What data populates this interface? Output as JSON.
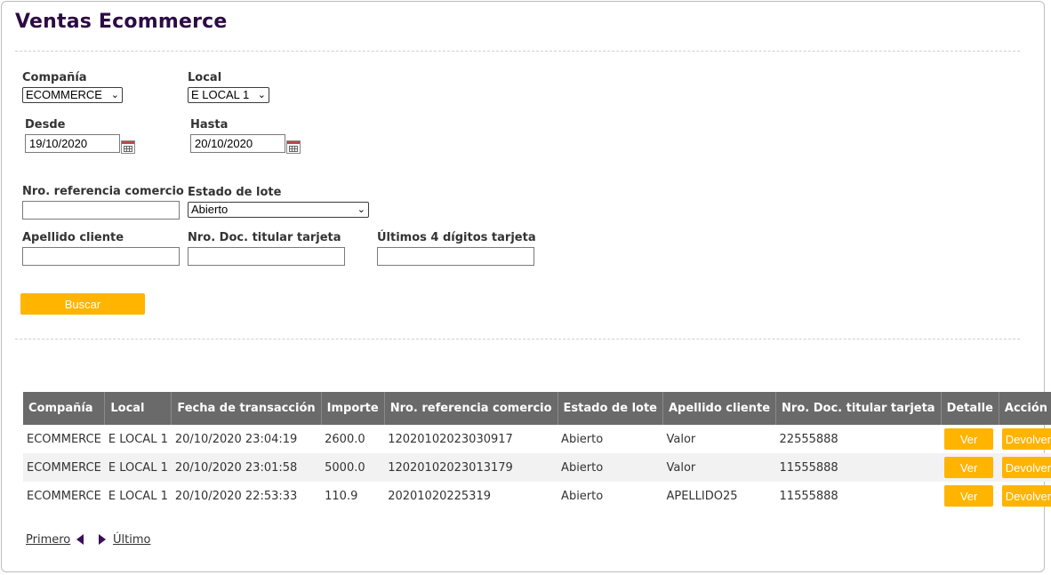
{
  "page": {
    "title": "Ventas Ecommerce"
  },
  "filters": {
    "compania": {
      "label": "Compañía",
      "value": "ECOMMERCE"
    },
    "local": {
      "label": "Local",
      "value": "E LOCAL 1"
    },
    "desde": {
      "label": "Desde",
      "value": "19/10/2020"
    },
    "hasta": {
      "label": "Hasta",
      "value": "20/10/2020"
    },
    "nro_referencia": {
      "label": "Nro. referencia comercio",
      "value": ""
    },
    "estado_lote": {
      "label": "Estado de lote",
      "value": "Abierto"
    },
    "apellido": {
      "label": "Apellido cliente",
      "value": ""
    },
    "nro_doc": {
      "label": "Nro. Doc. titular tarjeta",
      "value": ""
    },
    "ultimos4": {
      "label": "Últimos 4 dígitos tarjeta",
      "value": ""
    },
    "search_label": "Buscar"
  },
  "table": {
    "columns": [
      "Compañía",
      "Local",
      "Fecha de transacción",
      "Importe",
      "Nro. referencia comercio",
      "Estado de lote",
      "Apellido cliente",
      "Nro. Doc. titular tarjeta",
      "Detalle",
      "Acción"
    ],
    "rows": [
      {
        "compania": "ECOMMERCE",
        "local": "E LOCAL 1",
        "fecha": "20/10/2020 23:04:19",
        "importe": "2600.0",
        "referencia": "12020102023030917",
        "estado": "Abierto",
        "apellido": "Valor",
        "doc": "22555888",
        "detalle": "Ver",
        "accion": "Devolver"
      },
      {
        "compania": "ECOMMERCE",
        "local": "E LOCAL 1",
        "fecha": "20/10/2020 23:01:58",
        "importe": "5000.0",
        "referencia": "12020102023013179",
        "estado": "Abierto",
        "apellido": "Valor",
        "doc": "11555888",
        "detalle": "Ver",
        "accion": "Devolver"
      },
      {
        "compania": "ECOMMERCE",
        "local": "E LOCAL 1",
        "fecha": "20/10/2020 22:53:33",
        "importe": "110.9",
        "referencia": "20201020225319",
        "estado": "Abierto",
        "apellido": "APELLIDO25",
        "doc": "11555888",
        "detalle": "Ver",
        "accion": "Devolver"
      }
    ]
  },
  "pagination": {
    "first": "Primero",
    "last": "Último"
  },
  "icons": {
    "date_picker": "calendar-icon",
    "select_arrow": "chevron-down-icon",
    "prev": "triangle-left-icon",
    "next": "triangle-right-icon"
  },
  "colors": {
    "accent": "#ffb400",
    "title": "#2d0b43",
    "header_bg": "#6a6a6a",
    "pager_arrow": "#3b0f5c"
  }
}
